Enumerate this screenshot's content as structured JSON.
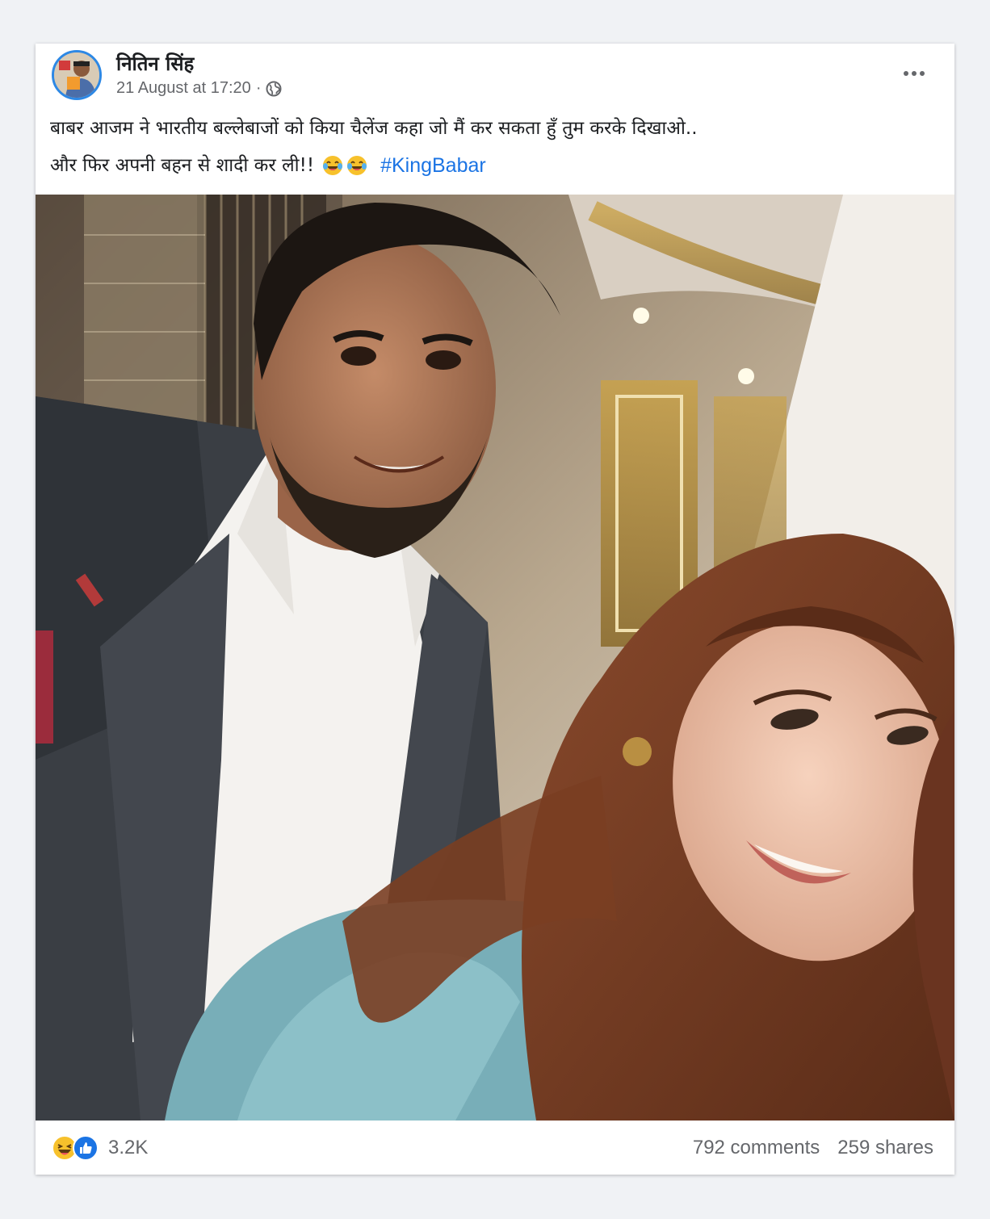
{
  "post": {
    "author": "नितिन सिंह",
    "timestamp": "21 August at 17:20",
    "separator": "·",
    "privacy_icon": "globe-icon",
    "text_line1": "बाबर आजम ने भारतीय बल्लेबाजों को किया चैलेंज कहा जो मैं कर सकता हुँ तुम करके दिखाओ..",
    "text_line2": "और फिर अपनी बहन से शादी कर ली!!",
    "emojis": [
      "laughing-tears-emoji",
      "laughing-tears-emoji"
    ],
    "hashtag": "#KingBabar"
  },
  "footer": {
    "reaction_icons": [
      "haha-reaction-icon",
      "like-reaction-icon"
    ],
    "reaction_count": "3.2K",
    "comments": "792 comments",
    "shares": "259 shares"
  },
  "colors": {
    "accent": "#1b74e4",
    "secondary_text": "#65676b",
    "background": "#f0f2f5"
  }
}
